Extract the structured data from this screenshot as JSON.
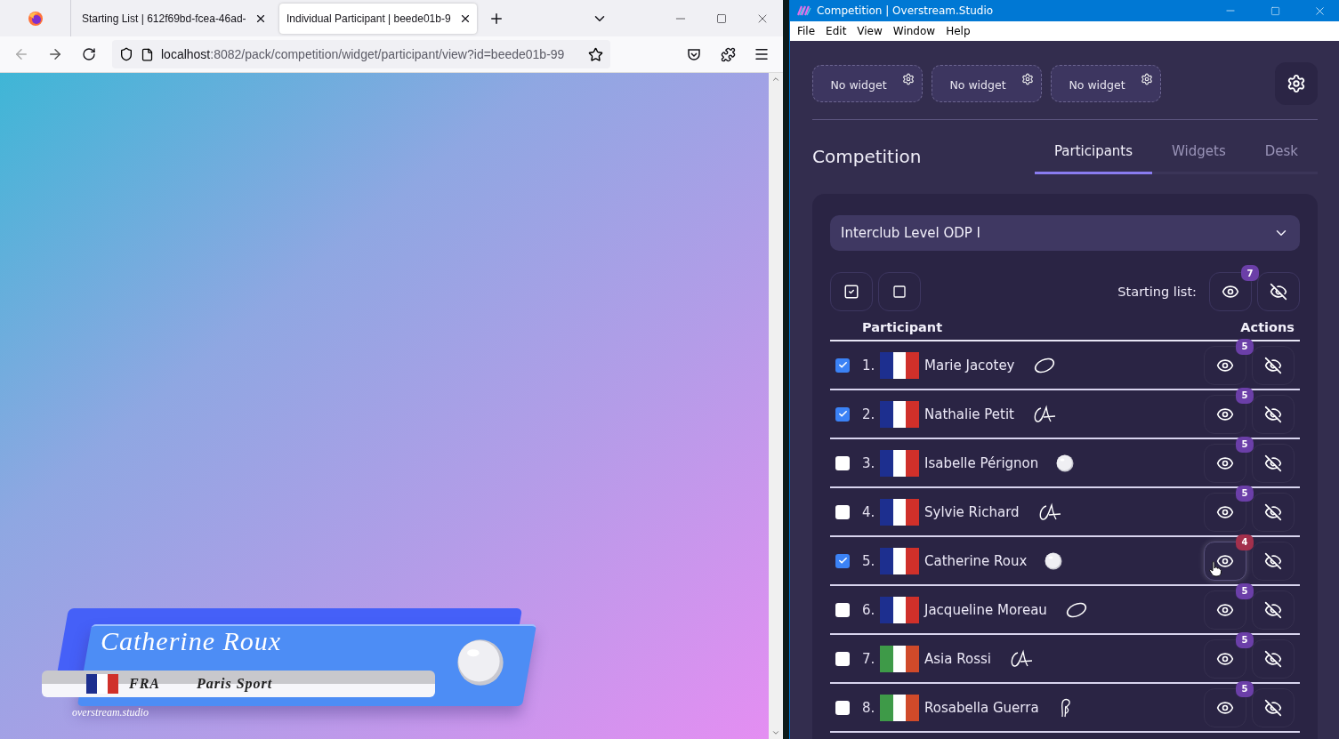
{
  "browser": {
    "tabs": [
      {
        "label": "Starting List | 612f69bd-fcea-46ad-",
        "selected": false
      },
      {
        "label": "Individual Participant | beede01b-9",
        "selected": true
      }
    ],
    "url": {
      "host": "localhost",
      "rest": ":8082/pack/competition/widget/participant/view?id=beede01b-99"
    }
  },
  "lower_third": {
    "name": "Catherine Roux",
    "country": "FRA",
    "club": "Paris Sport",
    "flag": {
      "kind": "france"
    },
    "apparatus": {
      "kind": "ball"
    },
    "credit": "overstream.studio"
  },
  "app": {
    "title": "Competition | Overstream.Studio",
    "menu": [
      "File",
      "Edit",
      "View",
      "Window",
      "Help"
    ],
    "widget_slots": [
      "No widget",
      "No widget",
      "No widget"
    ],
    "heading": "Competition",
    "tabs": [
      {
        "label": "Participants",
        "selected": true
      },
      {
        "label": "Widgets",
        "selected": false
      },
      {
        "label": "Desk",
        "selected": false
      }
    ],
    "competition_select": "Interclub Level ODP I",
    "starting_list": {
      "label": "Starting list:",
      "badge": "7"
    },
    "columns": [
      "Participant",
      "Actions"
    ],
    "participants": [
      {
        "number": "1.",
        "name": "Marie Jacotey",
        "flag": {
          "kind": "france"
        },
        "apparatus": {
          "kind": "hoop"
        },
        "checked": true,
        "badge": {
          "text": "5",
          "color": "#6b3fa8"
        },
        "hovered": false
      },
      {
        "number": "2.",
        "name": "Nathalie Petit",
        "flag": {
          "kind": "france"
        },
        "apparatus": {
          "kind": "ribbon"
        },
        "checked": true,
        "badge": {
          "text": "5",
          "color": "#6b3fa8"
        },
        "hovered": false
      },
      {
        "number": "3.",
        "name": "Isabelle Pérignon",
        "flag": {
          "kind": "france"
        },
        "apparatus": {
          "kind": "ball"
        },
        "checked": false,
        "badge": {
          "text": "5",
          "color": "#6b3fa8"
        },
        "hovered": false
      },
      {
        "number": "4.",
        "name": "Sylvie Richard",
        "flag": {
          "kind": "france"
        },
        "apparatus": {
          "kind": "ribbon"
        },
        "checked": false,
        "badge": {
          "text": "5",
          "color": "#6b3fa8"
        },
        "hovered": false
      },
      {
        "number": "5.",
        "name": "Catherine Roux",
        "flag": {
          "kind": "france"
        },
        "apparatus": {
          "kind": "ball"
        },
        "checked": true,
        "badge": {
          "text": "4",
          "color": "#a3304c"
        },
        "hovered": true
      },
      {
        "number": "6.",
        "name": "Jacqueline Moreau",
        "flag": {
          "kind": "france"
        },
        "apparatus": {
          "kind": "hoop"
        },
        "checked": false,
        "badge": {
          "text": "5",
          "color": "#6b3fa8"
        },
        "hovered": false
      },
      {
        "number": "7.",
        "name": "Asia Rossi",
        "flag": {
          "kind": "italy"
        },
        "apparatus": {
          "kind": "ribbon"
        },
        "checked": false,
        "badge": {
          "text": "5",
          "color": "#6b3fa8"
        },
        "hovered": false
      },
      {
        "number": "8.",
        "name": "Rosabella Guerra",
        "flag": {
          "kind": "italy"
        },
        "apparatus": {
          "kind": "clubs"
        },
        "checked": false,
        "badge": {
          "text": "5",
          "color": "#6b3fa8"
        },
        "hovered": false
      }
    ]
  }
}
